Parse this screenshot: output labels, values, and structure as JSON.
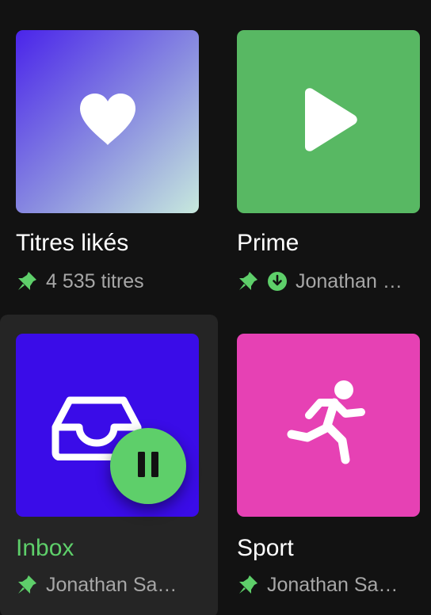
{
  "colors": {
    "background": "#121212",
    "accent_green": "#5ecf6a",
    "meta_text": "#a7a7a7",
    "liked_gradient_start": "#4a24ea",
    "liked_gradient_end": "#c7e9dd",
    "prime_cover": "#58b863",
    "inbox_cover": "#3a0ce8",
    "sport_cover": "#e641b4"
  },
  "playlists": [
    {
      "title": "Titres likés",
      "meta": "4 535 titres",
      "cover_icon": "heart-icon",
      "pinned": true,
      "downloaded": false,
      "playing": false
    },
    {
      "title": "Prime",
      "meta": "Jonathan …",
      "cover_icon": "play-icon",
      "pinned": true,
      "downloaded": true,
      "playing": false
    },
    {
      "title": "Inbox",
      "meta": "Jonathan Sa…",
      "cover_icon": "inbox-icon",
      "pinned": true,
      "downloaded": false,
      "playing": true,
      "control_icon": "pause-icon"
    },
    {
      "title": "Sport",
      "meta": "Jonathan Sa…",
      "cover_icon": "running-icon",
      "pinned": true,
      "downloaded": false,
      "playing": false
    }
  ]
}
